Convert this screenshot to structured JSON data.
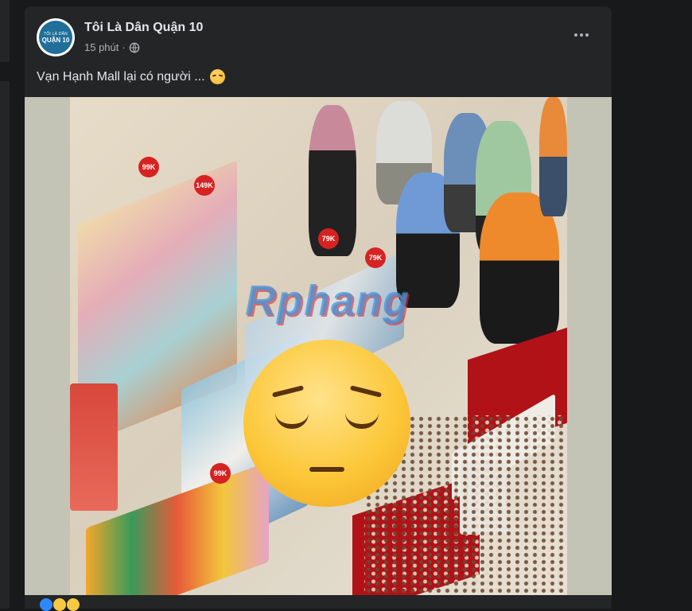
{
  "post": {
    "page_name": "Tôi Là Dân Quận 10",
    "avatar_top_text": "TÔI LÀ DÂN",
    "avatar_main_text": "QUẬN 10",
    "time": "15 phút",
    "separator": "·",
    "caption": "Vạn Hạnh Mall lại có người ...",
    "privacy_icon": "globe-icon",
    "more_icon": "more-options-icon"
  },
  "photo": {
    "watermark": "Rphang",
    "price_tags": [
      "99K",
      "149K",
      "79K",
      "79K",
      "99K"
    ],
    "overlay_emoji": "pensive-face"
  },
  "colors": {
    "background": "#18191a",
    "card": "#242526",
    "text_primary": "#e4e6eb",
    "text_secondary": "#b0b3b8"
  }
}
